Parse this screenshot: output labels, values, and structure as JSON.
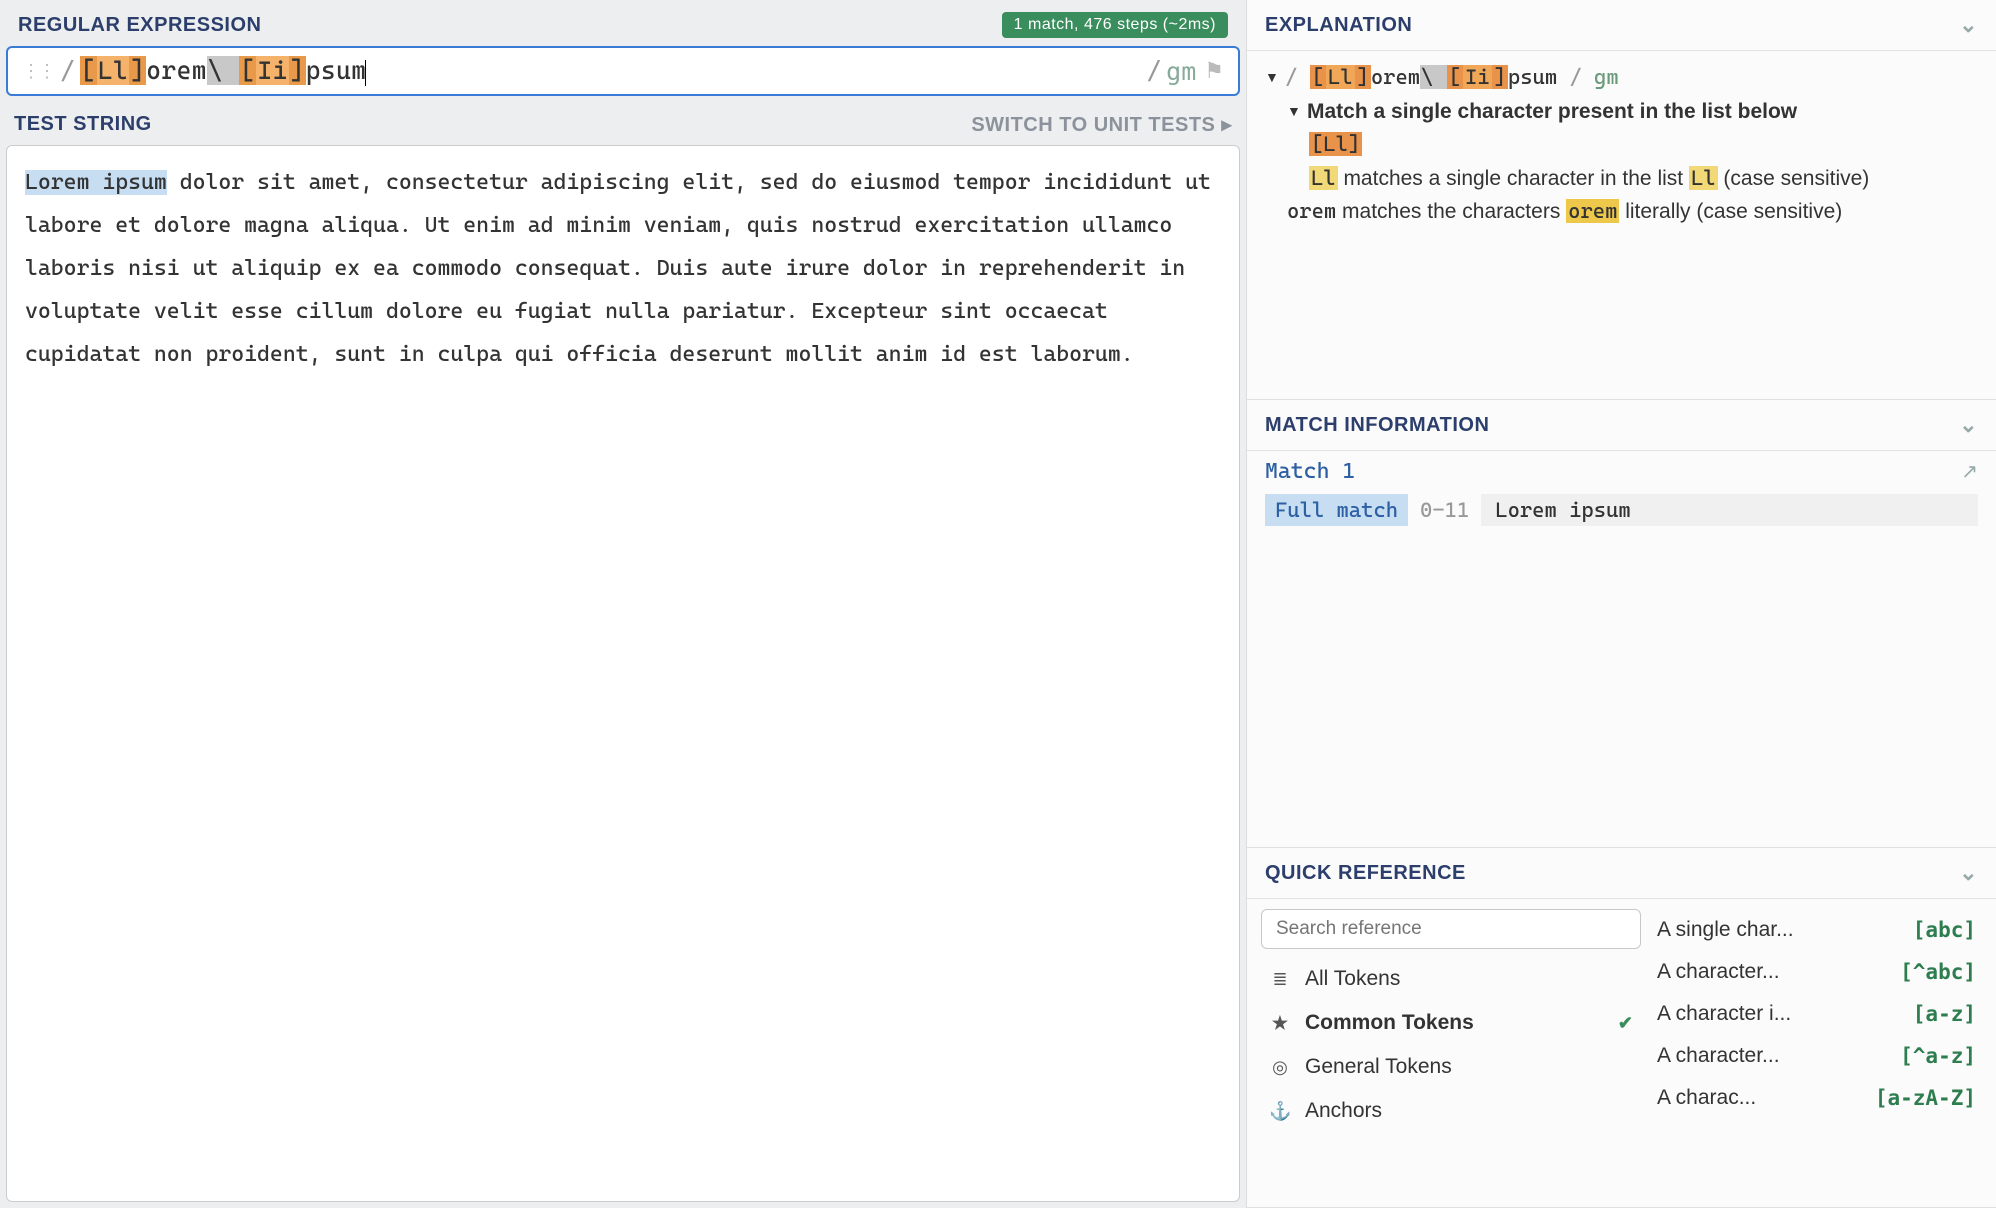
{
  "regex_section": {
    "title": "REGULAR EXPRESSION",
    "match_badge": "1 match, 476 steps (~2ms)",
    "delimiter": "/",
    "flags": "gm",
    "tokens": [
      {
        "t": "bracket",
        "v": "["
      },
      {
        "t": "cc",
        "v": "Ll"
      },
      {
        "t": "bracket",
        "v": "]"
      },
      {
        "t": "lit",
        "v": "orem"
      },
      {
        "t": "esc",
        "v": "\\ "
      },
      {
        "t": "bracket",
        "v": "["
      },
      {
        "t": "cc",
        "v": "Ii"
      },
      {
        "t": "bracket",
        "v": "]"
      },
      {
        "t": "lit",
        "v": "psum"
      }
    ]
  },
  "test_section": {
    "title": "TEST STRING",
    "switch_label": "SWITCH TO UNIT TESTS",
    "matched_prefix": "Lorem ipsum",
    "rest": " dolor sit amet, consectetur adipiscing elit, sed do eiusmod tempor incididunt ut labore et dolore magna aliqua. Ut enim ad minim veniam, quis nostrud exercitation ullamco laboris nisi ut aliquip ex ea commodo consequat. Duis aute irure dolor in reprehenderit in voluptate velit esse cillum dolore eu fugiat nulla pariatur. Excepteur sint occaecat cupidatat non proident, sunt in culpa qui officia deserunt mollit anim id est laborum."
  },
  "explanation": {
    "title": "EXPLANATION",
    "root_prefix": "/ ",
    "root_regex_tokens": [
      {
        "t": "bracket",
        "v": "["
      },
      {
        "t": "cc",
        "v": "Ll"
      },
      {
        "t": "bracket",
        "v": "]"
      },
      {
        "t": "lit",
        "v": "orem"
      },
      {
        "t": "esc",
        "v": "\\ "
      },
      {
        "t": "bracket",
        "v": "["
      },
      {
        "t": "cc",
        "v": "Ii"
      },
      {
        "t": "bracket",
        "v": "]"
      },
      {
        "t": "lit",
        "v": "psum"
      }
    ],
    "root_suffix_slash": " / ",
    "root_flags": "gm",
    "node_title": "Match a single character present in the list below",
    "node_token": "[Ll]",
    "line_Ll_a": "Ll",
    "line_Ll_b": " matches a single character in the list ",
    "line_Ll_c": "Ll",
    "line_Ll_d": " (case sensitive)",
    "line_orem_a": "orem",
    "line_orem_b": " matches the characters ",
    "line_orem_c": "orem",
    "line_orem_d": " literally (case sensitive)"
  },
  "match_info": {
    "title": "MATCH INFORMATION",
    "match_label": "Match 1",
    "full_match_label": "Full match",
    "range": "0-11",
    "text": "Lorem ipsum"
  },
  "quick_ref": {
    "title": "QUICK REFERENCE",
    "search_placeholder": "Search reference",
    "categories": [
      {
        "icon": "≣",
        "label": "All Tokens",
        "active": false
      },
      {
        "icon": "★",
        "label": "Common Tokens",
        "active": true
      },
      {
        "icon": "◎",
        "label": "General Tokens",
        "active": false
      },
      {
        "icon": "⚓",
        "label": "Anchors",
        "active": false
      }
    ],
    "items": [
      {
        "desc": "A single char...",
        "tok": "[abc]"
      },
      {
        "desc": "A character...",
        "tok": "[^abc]"
      },
      {
        "desc": "A character i...",
        "tok": "[a-z]"
      },
      {
        "desc": "A character...",
        "tok": "[^a-z]"
      },
      {
        "desc": "A charac...",
        "tok": "[a-zA-Z]"
      }
    ]
  }
}
